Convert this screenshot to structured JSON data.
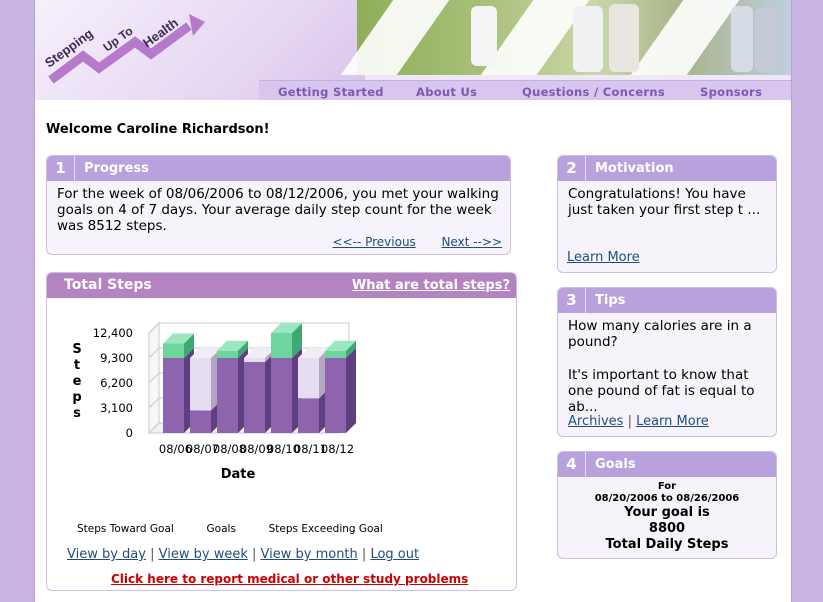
{
  "logo": {
    "line1": "Stepping",
    "line2": "Up To",
    "line3": "Health"
  },
  "nav": [
    "Getting Started",
    "About Us",
    "Questions / Concerns",
    "Sponsors"
  ],
  "welcome": "Welcome Caroline Richardson!",
  "progress": {
    "num": "1",
    "title": "Progress",
    "text": "For the week of 08/06/2006 to 08/12/2006, you met your walking goals on 4 of 7 days. Your average daily step count for the week was 8512 steps.",
    "prev": "<<-- Previous",
    "next": "Next -->>"
  },
  "total_steps": {
    "title": "Total Steps",
    "what_link": "What are total steps?",
    "legend": [
      "Steps Toward Goal",
      "Goals",
      "Steps Exceeding Goal"
    ],
    "view_by_day": "View by day",
    "view_by_week": "View by week",
    "view_by_month": "View by month",
    "log_out": "Log out",
    "report": "Click here to report medical or other study problems"
  },
  "chart_data": {
    "type": "bar",
    "ylabel": "Steps",
    "xlabel": "Date",
    "ylim": [
      0,
      12400
    ],
    "yticks": [
      "12,400",
      "9,300",
      "6,200",
      "3,100",
      "0"
    ],
    "categories": [
      "08/06",
      "08/07",
      "08/08",
      "08/09",
      "08/10",
      "08/11",
      "08/12"
    ],
    "series": [
      {
        "name": "Steps Toward Goal",
        "values": [
          9300,
          2800,
          9300,
          8800,
          9300,
          4300,
          9300
        ]
      },
      {
        "name": "Goals",
        "values": [
          0,
          6500,
          0,
          500,
          0,
          5000,
          0
        ]
      },
      {
        "name": "Steps Exceeding Goal",
        "values": [
          1800,
          0,
          900,
          0,
          3100,
          0,
          900
        ]
      }
    ],
    "colors": {
      "toward": "#8d64ad",
      "goal": "#e6dcef",
      "exceed": "#6ed59e",
      "grid": "#c8c8c8"
    }
  },
  "motivation": {
    "num": "2",
    "title": "Motivation",
    "text": "Congratulations! You have just taken your first step t ...",
    "learn_more": "Learn More"
  },
  "tips": {
    "num": "3",
    "title": "Tips",
    "question": "How many calories are in a pound?",
    "text": "It's important to know that one pound of fat is equal to ab...",
    "archives": "Archives",
    "learn_more": "Learn More"
  },
  "goals": {
    "num": "4",
    "title": "Goals",
    "for": "For",
    "range": "08/20/2006 to 08/26/2006",
    "line1": "Your goal is",
    "value": "8800",
    "line2": "Total Daily Steps"
  }
}
